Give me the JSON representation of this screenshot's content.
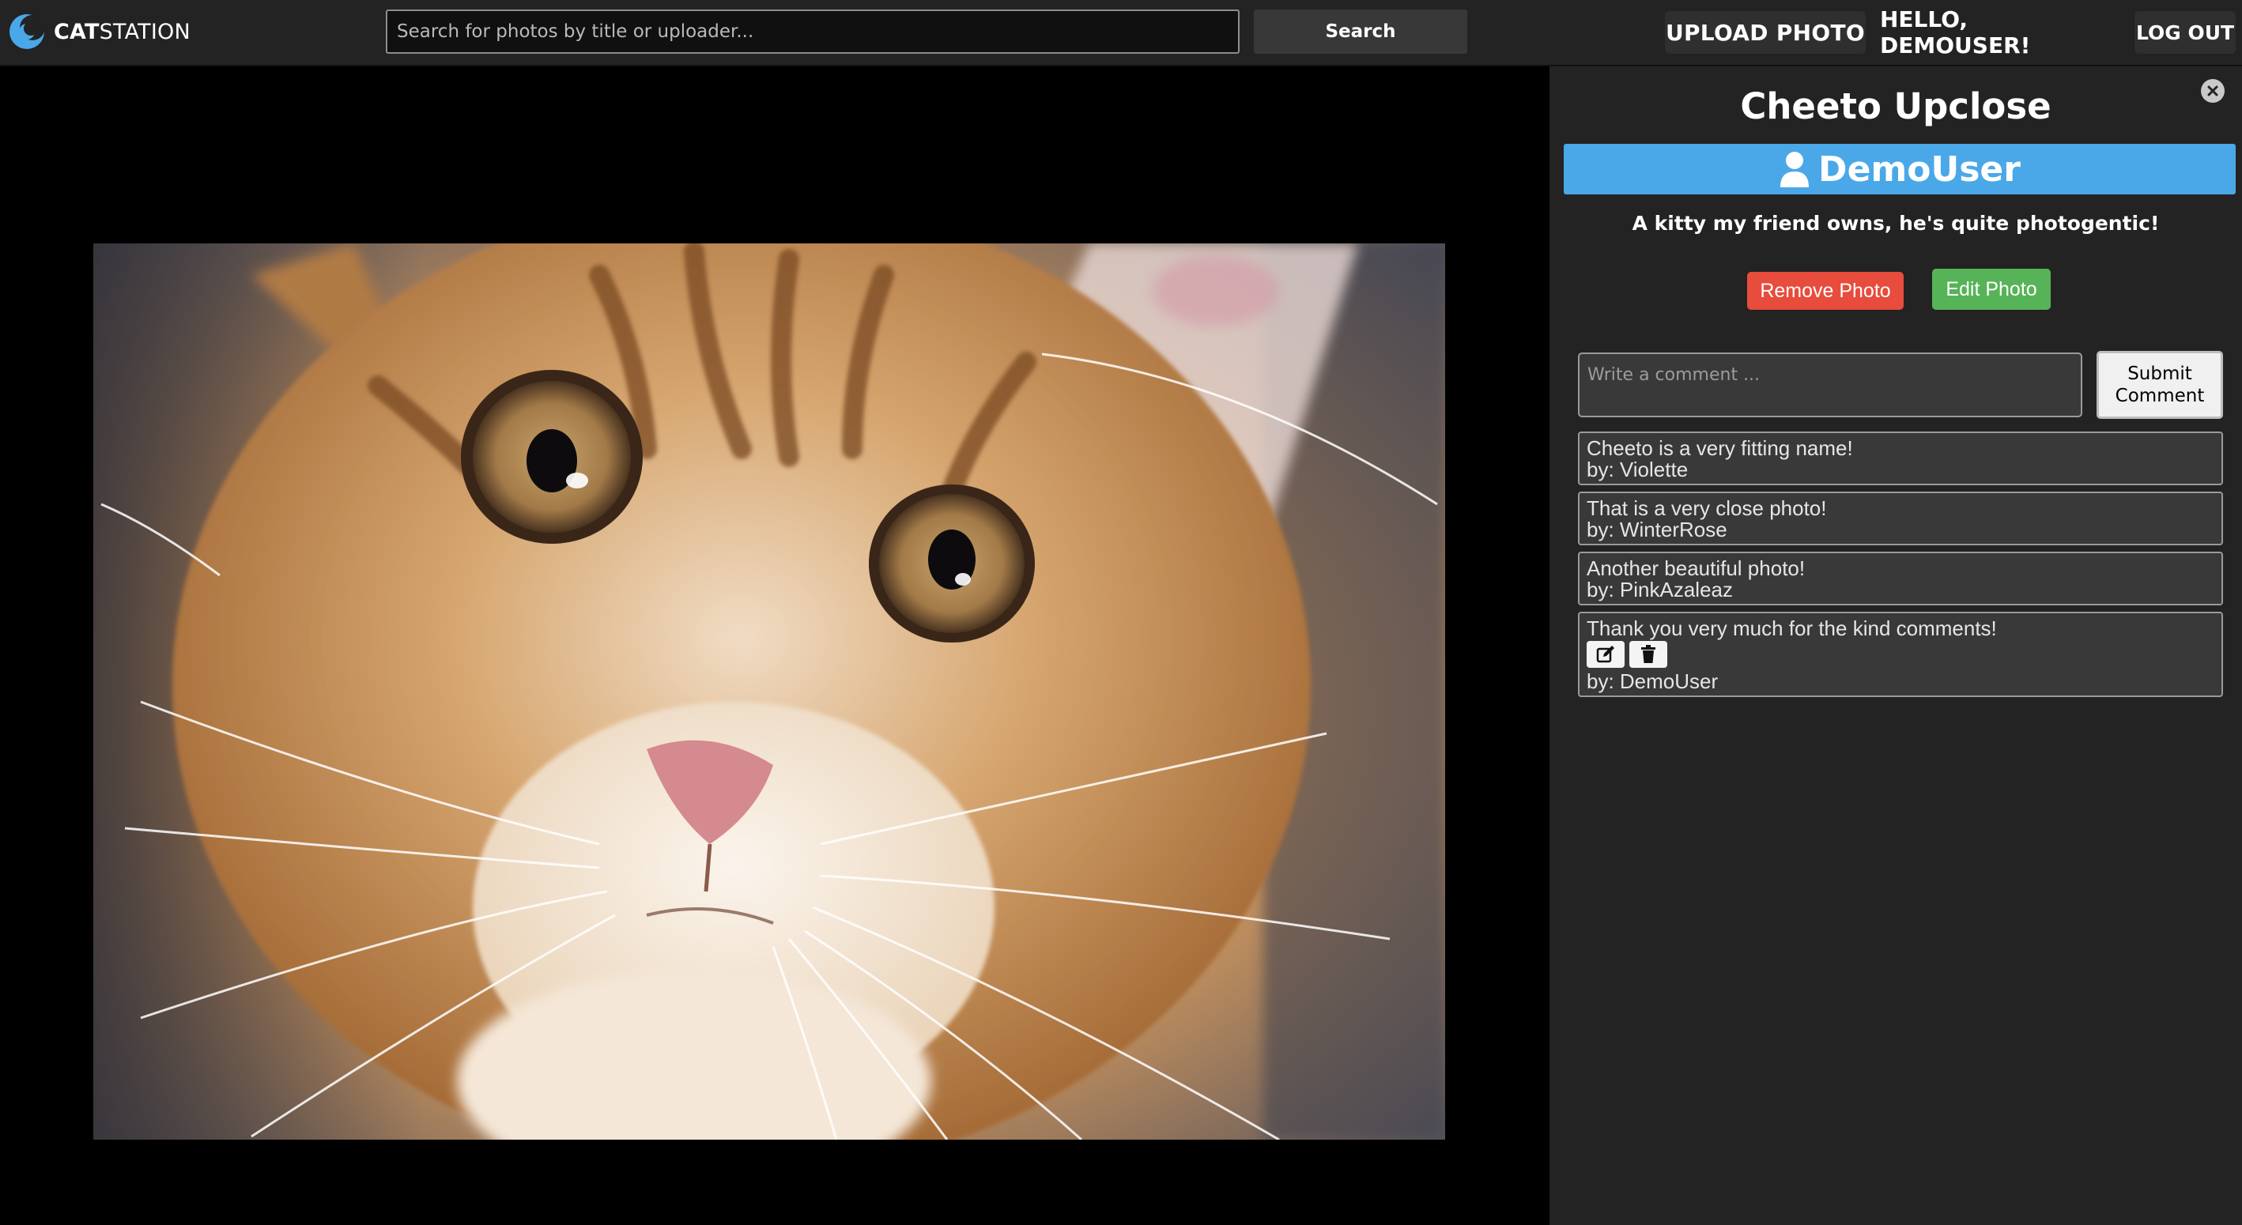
{
  "header": {
    "logo_bold": "CAT",
    "logo_light": "STATION",
    "search_placeholder": "Search for photos by title or uploader...",
    "search_button": "Search",
    "upload_button": "UPLOAD PHOTO",
    "greeting": "HELLO, DEMOUSER!",
    "logout_button": "LOG OUT"
  },
  "photo": {
    "title": "Cheeto Upclose",
    "uploader": "DemoUser",
    "description": "A kitty my friend owns, he's quite photogentic!",
    "remove_button": "Remove Photo",
    "edit_button": "Edit Photo"
  },
  "comment_form": {
    "placeholder": "Write a comment ...",
    "submit_button": "Submit Comment"
  },
  "comments": [
    {
      "text": "Cheeto is a very fitting name!",
      "author": "by: Violette"
    },
    {
      "text": "That is a very close photo!",
      "author": "by: WinterRose"
    },
    {
      "text": "Another beautiful photo!",
      "author": "by: PinkAzaleaz"
    },
    {
      "text": "Thank you very much for the kind comments!",
      "author": "by: DemoUser"
    }
  ],
  "colors": {
    "uploader_bar": "#4aa8e8",
    "remove_button": "#e74c3c",
    "edit_button": "#57b357",
    "panel_bg": "#232323"
  },
  "icons": {
    "logo": "catstation-logo-icon",
    "close": "close-icon",
    "user": "user-icon",
    "edit": "edit-icon",
    "delete": "trash-icon"
  }
}
